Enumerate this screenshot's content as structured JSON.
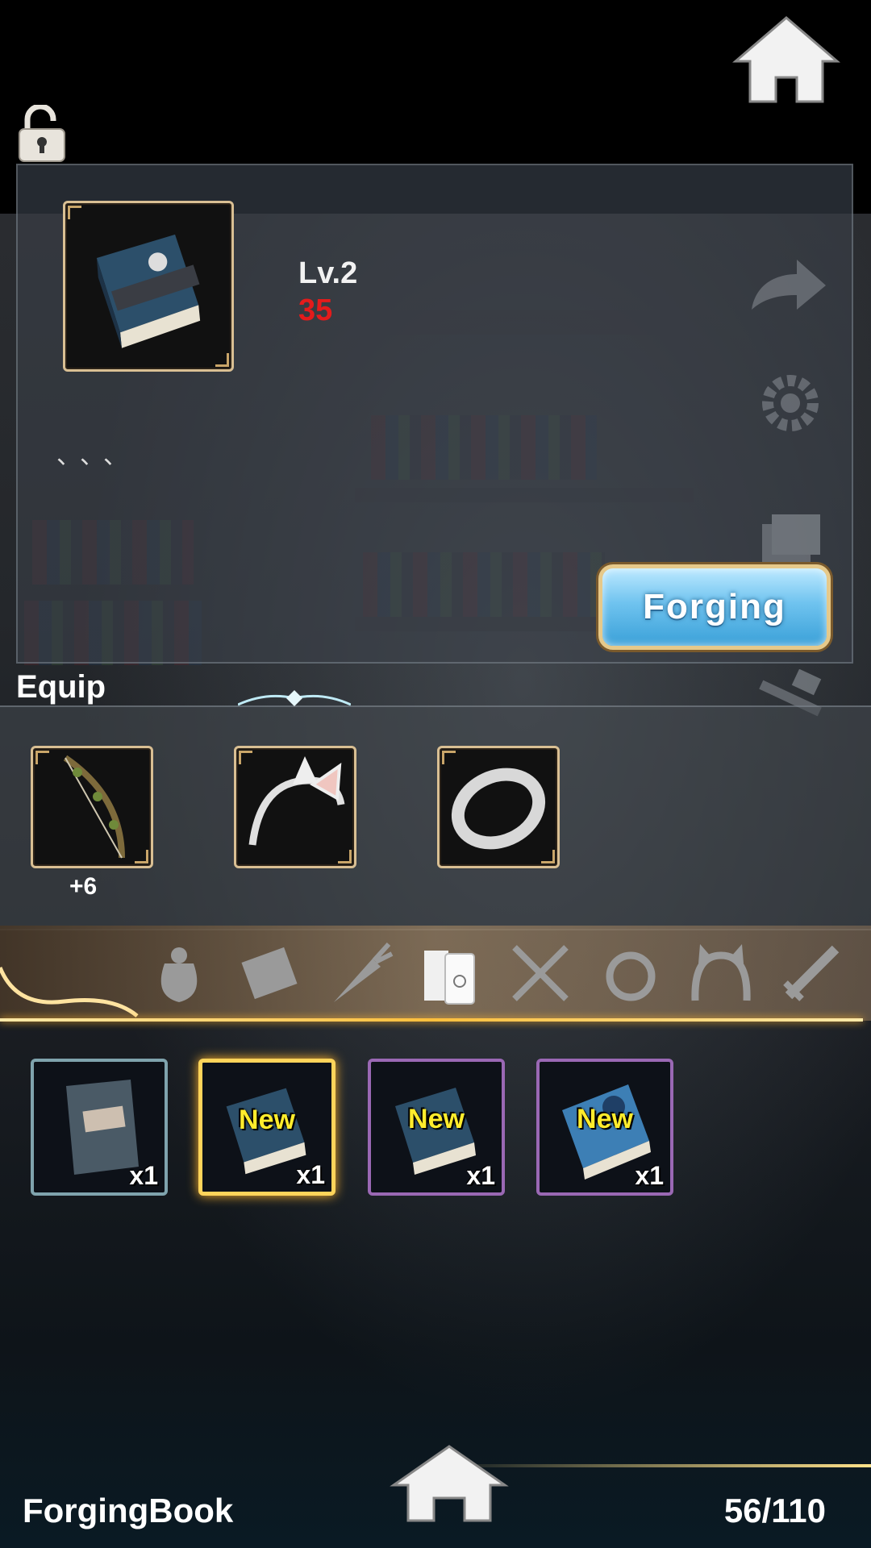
{
  "item": {
    "level": "Lv.2",
    "value": "35",
    "description": "、、、"
  },
  "buttons": {
    "forging": "Forging"
  },
  "equip": {
    "title": "Equip",
    "slots": [
      {
        "icon": "bow-icon",
        "bonus": "+6"
      },
      {
        "icon": "cat-ear-headband-icon",
        "bonus": ""
      },
      {
        "icon": "silver-ring-icon",
        "bonus": ""
      }
    ]
  },
  "tabs": [
    {
      "icon": "pouch-icon"
    },
    {
      "icon": "letter-icon"
    },
    {
      "icon": "carrot-icon"
    },
    {
      "icon": "books-icon",
      "selected": true
    },
    {
      "icon": "spoon-fork-icon"
    },
    {
      "icon": "ring-icon"
    },
    {
      "icon": "headband-icon"
    },
    {
      "icon": "sword-icon"
    }
  ],
  "inventory": [
    {
      "icon": "worn-book-icon",
      "new": "",
      "qty": "x1",
      "rarity": "teal"
    },
    {
      "icon": "forging-book-icon",
      "new": "New",
      "qty": "x1",
      "rarity": "gold"
    },
    {
      "icon": "forging-book-icon",
      "new": "New",
      "qty": "x1",
      "rarity": "purple"
    },
    {
      "icon": "blue-book-icon",
      "new": "New",
      "qty": "x1",
      "rarity": "purple"
    }
  ],
  "footer": {
    "title": "ForgingBook",
    "count": "56/110"
  },
  "colors": {
    "level_value": "#e41b1b",
    "new_badge": "#ffec2c",
    "tab_line": "#ffbf3c"
  }
}
